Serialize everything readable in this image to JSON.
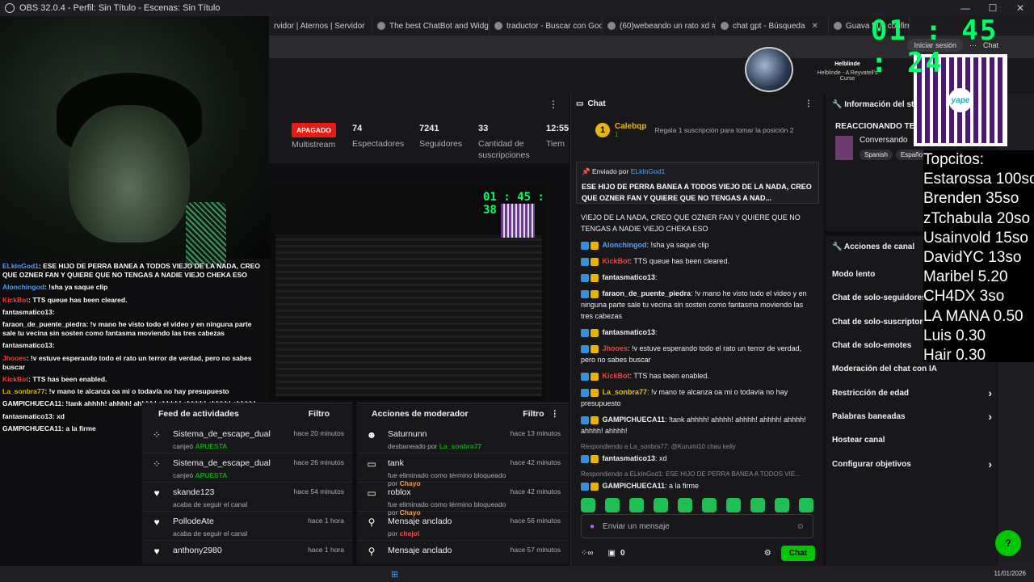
{
  "obs": {
    "title": "OBS 32.0.4 - Perfil: Sin Título - Escenas: Sin Título"
  },
  "browser": {
    "tabs": [
      "rvidor | Aternos | Servidor",
      "The best ChatBot and Widge",
      "traductor - Buscar con Goog",
      "(60)webeando un rato xd #",
      "chat gpt - Búsqueda",
      "Guava fruit confirmed"
    ],
    "login_label": "Iniciar sesión",
    "chat_label": "Chat"
  },
  "channel": {
    "name": "Helblinde",
    "subtitle": "Helblinde - A Reyvatell's Curse"
  },
  "timer": "01 : 45 : 24",
  "qr": {
    "brand": "yape"
  },
  "topcitos": {
    "title": "Topcitos:",
    "entries": [
      "Estarossa 100so",
      "Brenden 35so",
      "zTchabula 20so",
      "Usainvold 15so",
      "DavidYC 13so",
      "Maribel 5.20",
      "CH4DX 3so",
      "LA MANA 0.50",
      "Luis 0.30",
      "Hair 0.30"
    ]
  },
  "overlay_chat": [
    {
      "user": "ELkInGod1",
      "color": "#4aa3ff",
      "text": ": ESE HIJO DE PERRA BANEA A TODOS VIEJO DE LA NADA, CREO QUE OZNER FAN Y QUIERE QUE NO TENGAS A NADIE VIEJO CHEKA ESO"
    },
    {
      "user": "Alonchingod",
      "color": "#4aa3ff",
      "text": ": !sha ya saque clip"
    },
    {
      "user": "KickBot",
      "color": "#ff3b3b",
      "text": ": TTS queue has been cleared."
    },
    {
      "user": "fantasmatico13",
      "color": "#ffffff",
      "text": ":"
    },
    {
      "user": "faraon_de_puente_piedra",
      "color": "#ffffff",
      "text": ": !v mano he visto todo el video y en ninguna parte sale tu vecina sin sosten como fantasma moviendo las tres cabezas"
    },
    {
      "user": "fantasmatico13",
      "color": "#ffffff",
      "text": ":"
    },
    {
      "user": "Jhooes",
      "color": "#ff3b3b",
      "text": ": !v estuve esperando todo el rato un terror de verdad, pero no sabes buscar"
    },
    {
      "user": "KickBot",
      "color": "#ff3b3b",
      "text": ": TTS has been enabled."
    },
    {
      "user": "La_sonbra77",
      "color": "#e0c000",
      "text": ": !v mano te alcanza oa mi o todavía no hay presupuesto"
    },
    {
      "user": "GAMPICHUECA11",
      "color": "#ffffff",
      "text": ": !tank ahhhh! ahhhh! ahhhh! ahhhh! ahhhh! ahhhh! ahhhh!"
    },
    {
      "user": "fantasmatico13",
      "color": "#ffffff",
      "text": ": xd"
    },
    {
      "user": "GAMPICHUECA11",
      "color": "#ffffff",
      "text": ": a la firme"
    }
  ],
  "stats": {
    "status": "APAGADO",
    "multistream": "Multistream",
    "viewers": {
      "value": "74",
      "label": "Espectadores"
    },
    "followers": {
      "value": "7241",
      "label": "Seguidores"
    },
    "subs": {
      "value": "33",
      "label": "Cantidad de suscripciones"
    },
    "time": {
      "value": "12:55",
      "label": "Tiem"
    }
  },
  "preview": {
    "timer": "01 : 45 : 38"
  },
  "activity_feed": {
    "title": "Feed de actividades",
    "filter": "Filtro",
    "items": [
      {
        "icon": "channel-points-icon",
        "user": "Sistema_de_escape_dual",
        "action": "canjeó",
        "detail": "APUESTA",
        "time": "hace 20 minutos"
      },
      {
        "icon": "channel-points-icon",
        "user": "Sistema_de_escape_dual",
        "action": "canjeó",
        "detail": "APUESTA",
        "time": "hace 26 minutos"
      },
      {
        "icon": "heart-icon",
        "user": "skande123",
        "action": "acaba de seguir el canal",
        "detail": "",
        "time": "hace 54 minutos"
      },
      {
        "icon": "heart-icon",
        "user": "PollodeAte",
        "action": "acaba de seguir el canal",
        "detail": "",
        "time": "hace 1 hora"
      },
      {
        "icon": "heart-icon",
        "user": "anthony2980",
        "action": "",
        "detail": "",
        "time": "hace 1 hora"
      }
    ]
  },
  "mod_actions": {
    "title": "Acciones de moderador",
    "filter": "Filtro",
    "items": [
      {
        "icon": "unban-icon",
        "title": "Saturnunn",
        "sub": "desbaneado por",
        "by": "La_sonbra77",
        "by_color": "green",
        "time": "hace 13 minutos"
      },
      {
        "icon": "chat-icon",
        "title": "tank",
        "sub": "fue eliminado como término bloqueado por",
        "by": "Chayo",
        "by_color": "orange",
        "time": "hace 42 minutos"
      },
      {
        "icon": "chat-icon",
        "title": "roblox",
        "sub": "fue eliminado como término bloqueado por",
        "by": "Chayo",
        "by_color": "orange",
        "time": "hace 42 minutos"
      },
      {
        "icon": "pin-icon",
        "title": "Mensaje anclado",
        "sub": "por",
        "by": "chejol",
        "by_color": "red",
        "time": "hace 56 minutos"
      },
      {
        "icon": "pin-icon",
        "title": "Mensaje anclado",
        "sub": "",
        "by": "",
        "by_color": "red",
        "time": "hace 57 minutos"
      }
    ]
  },
  "chat": {
    "title": "Chat",
    "top_gifter": {
      "rank": "1",
      "user": "Calebqp",
      "count": "1",
      "text": "Regala 1 suscripción para tomar la posición 2"
    },
    "pinned": {
      "label": "Enviado por",
      "user": "ELkInGod1",
      "message": "ESE HIJO DE PERRA BANEA A TODOS VIEJO DE LA NADA, CREO QUE OZNER FAN Y QUIERE QUE NO TENGAS A NAD..."
    },
    "messages": [
      {
        "user": "",
        "color": "#efeff1",
        "text": "VIEJO DE LA NADA, CREO QUE OZNER FAN Y QUIERE QUE NO TENGAS A NADIE VIEJO CHEKA ESO",
        "reply": ""
      },
      {
        "user": "Alonchingod",
        "color": "#4aa3ff",
        "text": ": !sha ya saque clip",
        "reply": ""
      },
      {
        "user": "KickBot",
        "color": "#ff3b3b",
        "text": ": TTS queue has been cleared.",
        "reply": ""
      },
      {
        "user": "fantasmatico13",
        "color": "#efeff1",
        "text": ":",
        "reply": ""
      },
      {
        "user": "faraon_de_puente_piedra",
        "color": "#efeff1",
        "text": ": !v mano he visto todo el video y en ninguna parte sale tu vecina sin sosten como fantasma moviendo las tres cabezas",
        "reply": ""
      },
      {
        "user": "fantasmatico13",
        "color": "#efeff1",
        "text": ":",
        "reply": ""
      },
      {
        "user": "Jhooes",
        "color": "#ff3b3b",
        "text": ": !v estuve esperando todo el rato un terror de verdad, pero no sabes buscar",
        "reply": ""
      },
      {
        "user": "KickBot",
        "color": "#ff3b3b",
        "text": ": TTS has been enabled.",
        "reply": ""
      },
      {
        "user": "La_sonbra77",
        "color": "#e0c000",
        "text": ": !v mano te alcanza oa mi o todavía no hay presupuesto",
        "reply": ""
      },
      {
        "user": "GAMPICHUECA11",
        "color": "#efeff1",
        "text": ": !tank ahhhh! ahhhh! ahhhh! ahhhh! ahhhh! ahhhh! ahhhh!",
        "reply": ""
      },
      {
        "user": "fantasmatico13",
        "color": "#efeff1",
        "text": ": xd",
        "reply": "Respondiendo a La_sonbra77: @Kurumi10 chau kelly"
      },
      {
        "user": "GAMPICHUECA11",
        "color": "#efeff1",
        "text": ": a la firme",
        "reply": "Respondiendo a ELkInGod1: ESE HIJO DE PERRA BANEA A TODOS VIE..."
      }
    ],
    "input_placeholder": "Enviar un mensaje",
    "points": "0",
    "send_label": "Chat"
  },
  "info": {
    "title": "Información del stream",
    "stream_title": "REACCIONANDO TER",
    "category": "Conversando",
    "tags": [
      "Spanish",
      "Españo"
    ]
  },
  "actions": {
    "title": "Acciones de canal",
    "items": [
      {
        "label": "Modo lento",
        "chevron": false
      },
      {
        "label": "Chat de solo-seguidores",
        "chevron": false
      },
      {
        "label": "Chat de solo-suscriptores",
        "chevron": false
      },
      {
        "label": "Chat de solo-emotes",
        "chevron": false
      },
      {
        "label": "Moderación del chat con IA",
        "chevron": false
      },
      {
        "label": "Restricción de edad",
        "chevron": true
      },
      {
        "label": "Palabras baneadas",
        "chevron": true
      },
      {
        "label": "Hostear canal",
        "chevron": false
      },
      {
        "label": "Configurar objetivos",
        "chevron": true
      }
    ]
  },
  "taskbar": {
    "date": "11/01/2026"
  }
}
